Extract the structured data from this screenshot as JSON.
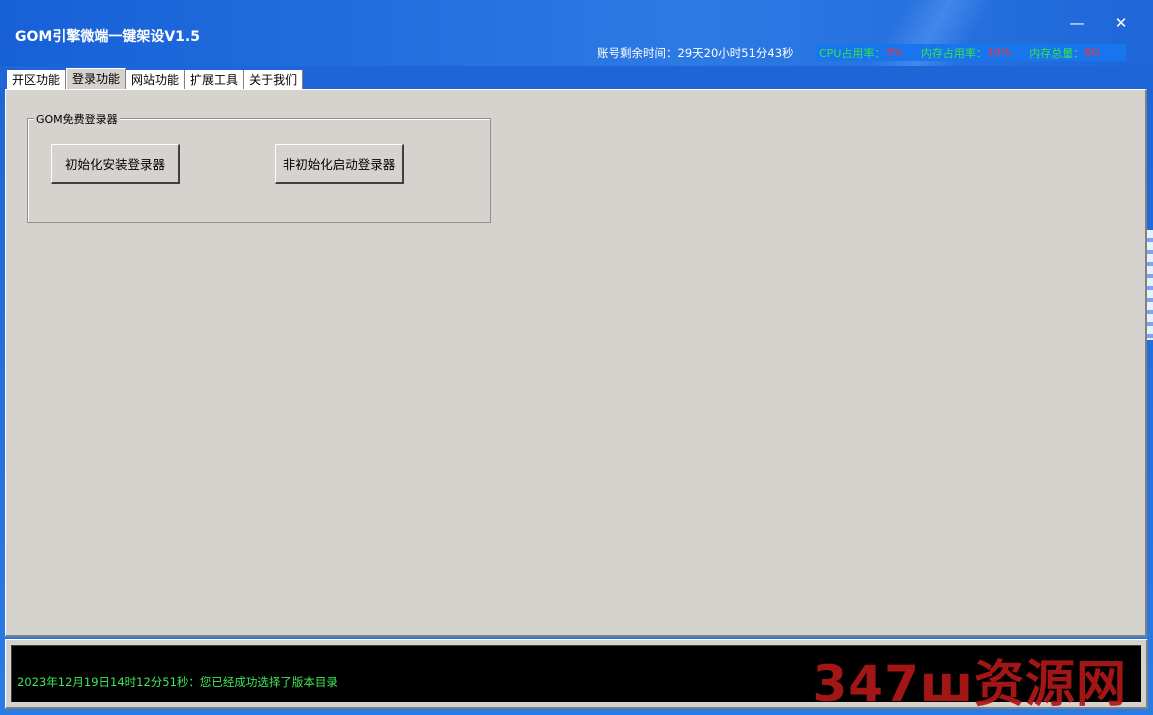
{
  "window": {
    "title": "GOM引擎微端一键架设V1.5",
    "minimize_glyph": "—",
    "close_glyph": "✕",
    "account_time": "账号剩余时间：29天20小时51分43秒"
  },
  "stats": {
    "cpu_label": "CPU占用率：",
    "cpu_value": "3%",
    "mem_label": "内存占用率：",
    "mem_value": "10%",
    "total_label": "内存总量：",
    "total_value": "8G",
    "label_color": "#34e64a",
    "value_color": "#ff3030"
  },
  "tabs": [
    {
      "label": "开区功能"
    },
    {
      "label": "登录功能"
    },
    {
      "label": "网站功能"
    },
    {
      "label": "扩展工具"
    },
    {
      "label": "关于我们"
    }
  ],
  "login_group": {
    "title": "GOM免费登录器",
    "init_button": "初始化安装登录器",
    "noninit_button": "非初始化启动登录器"
  },
  "log": {
    "message": "2023年12月19日14时12分51秒：您已经成功选择了版本目录"
  },
  "watermark": {
    "text": "347ш资源网"
  }
}
